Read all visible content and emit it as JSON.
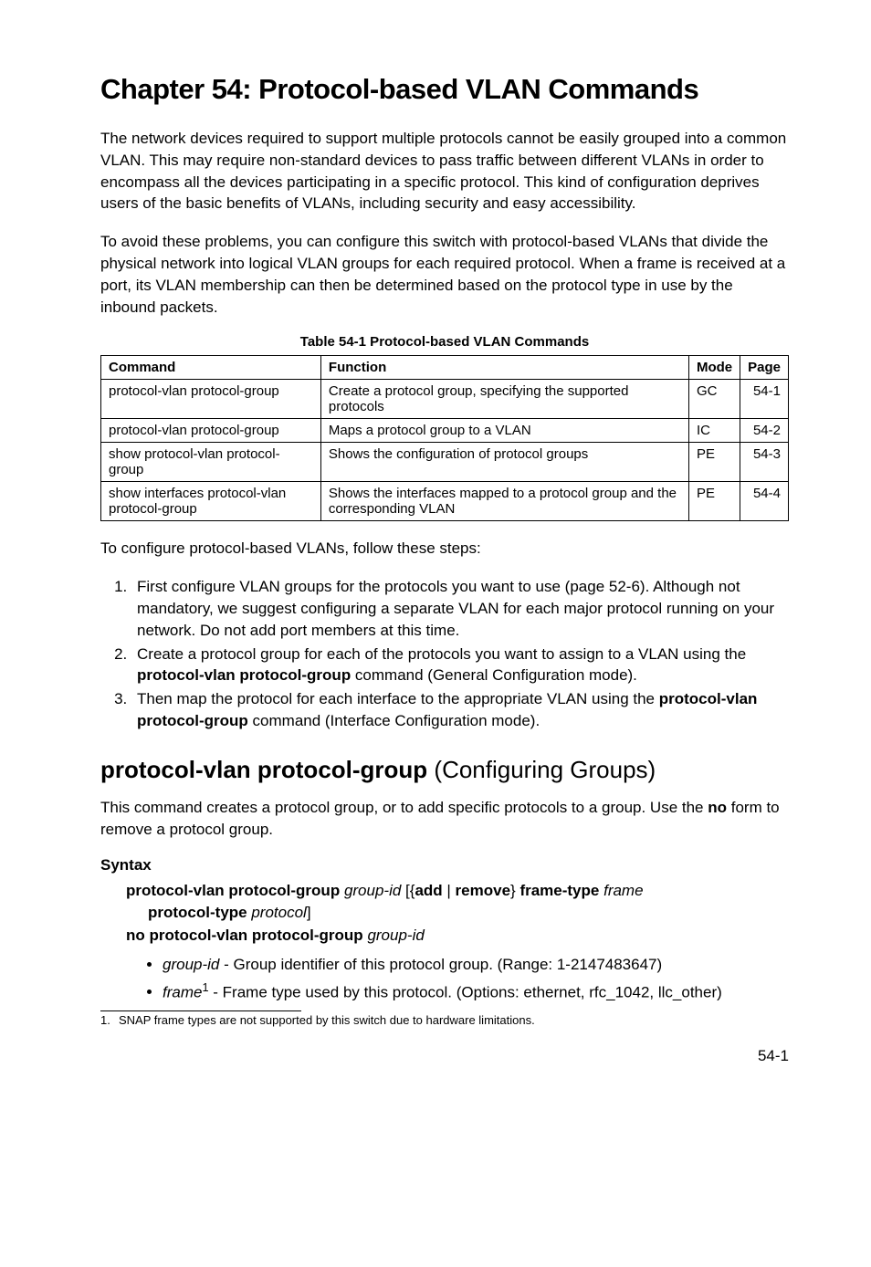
{
  "header": {
    "chapter_title": "Chapter 54: Protocol-based VLAN  Commands"
  },
  "intro": {
    "p1": "The network devices required to support multiple protocols cannot be easily grouped into a common VLAN. This may require non-standard devices to pass traffic between different VLANs in order to encompass all the devices participating in a specific protocol. This kind of configuration deprives users of the basic benefits of VLANs, including security and easy accessibility.",
    "p2": "To avoid these problems, you can configure this switch with protocol-based VLANs that divide the physical network into logical VLAN groups for each required protocol. When a frame is received at a port, its VLAN membership can then be determined based on the protocol type in use by the inbound packets."
  },
  "table": {
    "caption": "Table 54-1   Protocol-based VLAN Commands",
    "headers": {
      "command": "Command",
      "function": "Function",
      "mode": "Mode",
      "page": "Page"
    },
    "rows": [
      {
        "command": "protocol-vlan protocol-group",
        "function": "Create a protocol group, specifying the supported protocols",
        "mode": "GC",
        "page": "54-1"
      },
      {
        "command": "protocol-vlan protocol-group",
        "function": "Maps a protocol group to a VLAN",
        "mode": "IC",
        "page": "54-2"
      },
      {
        "command": "show protocol-vlan protocol-group",
        "function": "Shows the configuration of protocol groups",
        "mode": "PE",
        "page": "54-3"
      },
      {
        "command": "show interfaces protocol-vlan protocol-group",
        "function": "Shows the interfaces mapped to a protocol group and the corresponding VLAN",
        "mode": "PE",
        "page": "54-4"
      }
    ]
  },
  "steps": {
    "intro": "To configure protocol-based VLANs, follow these steps:",
    "items": [
      "First configure VLAN groups for the protocols you want to use (page 52-6). Although not mandatory, we suggest configuring a separate VLAN for each major protocol running on your network. Do not add port members at this time.",
      "Create a protocol group for each of the protocols you want to assign to a VLAN using the <strong>protocol-vlan protocol-group</strong> command (General Configuration mode).",
      "Then map the protocol for each interface to the appropriate VLAN using the <strong>protocol-vlan protocol-group</strong> command (Interface Configuration mode)."
    ]
  },
  "section": {
    "h2_bold": "protocol-vlan protocol-group",
    "h2_thin": " (Configuring Groups)",
    "desc": "This command creates a protocol group, or to add specific protocols to a group. Use the <strong>no</strong> form to remove a protocol group.",
    "syntax_label": "Syntax",
    "syntax_line1": "<strong>protocol-vlan protocol-group</strong> <em>group-id</em> [{<strong>add</strong> | <strong>remove</strong>} <strong>frame-type</strong> <em>frame</em>",
    "syntax_line2": "<strong>protocol-type</strong> <em>protocol</em>]",
    "syntax_line3": "<strong>no protocol-vlan protocol-group</strong> <em>group-id</em>",
    "bullets": [
      "<em>group-id</em> - Group identifier of this protocol group. (Range: 1-2147483647)",
      "<em>frame</em><sup>1</sup> - Frame type used by this protocol. (Options: ethernet, rfc_1042, llc_other)"
    ]
  },
  "footnote": {
    "num": "1.",
    "text": "SNAP frame types are not supported by this switch due to hardware limitations."
  },
  "page_number": "54-1",
  "chart_data": {
    "type": "table",
    "title": "Table 54-1 Protocol-based VLAN Commands",
    "columns": [
      "Command",
      "Function",
      "Mode",
      "Page"
    ],
    "rows": [
      [
        "protocol-vlan protocol-group",
        "Create a protocol group, specifying the supported protocols",
        "GC",
        "54-1"
      ],
      [
        "protocol-vlan protocol-group",
        "Maps a protocol group to a VLAN",
        "IC",
        "54-2"
      ],
      [
        "show protocol-vlan protocol-group",
        "Shows the configuration of protocol groups",
        "PE",
        "54-3"
      ],
      [
        "show interfaces protocol-vlan protocol-group",
        "Shows the interfaces mapped to a protocol group and the corresponding VLAN",
        "PE",
        "54-4"
      ]
    ]
  }
}
